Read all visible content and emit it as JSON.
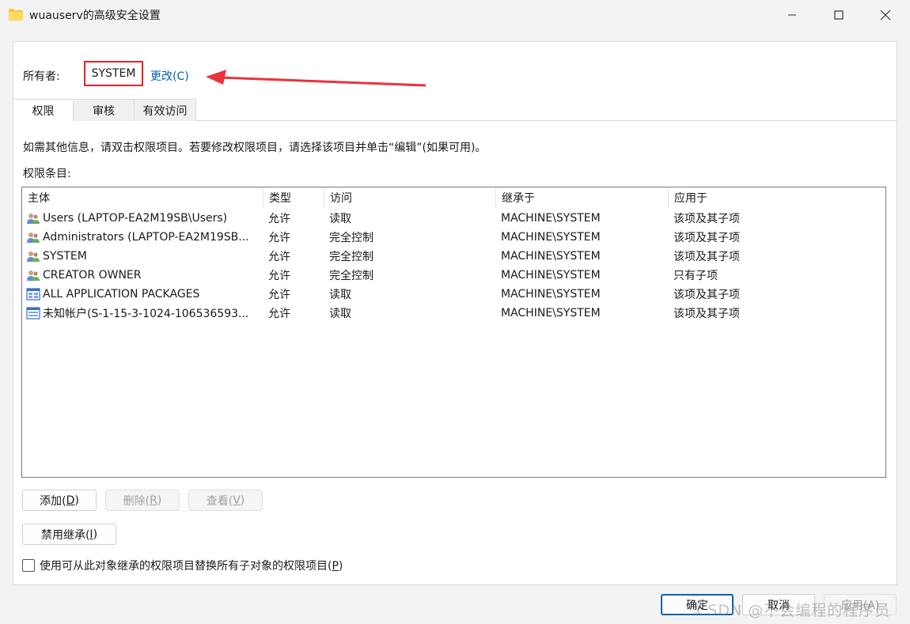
{
  "window": {
    "title": "wuauserv的高级安全设置",
    "icon": "folder-icon"
  },
  "owner": {
    "label": "所有者:",
    "value": "SYSTEM",
    "change_link": "更改(C)"
  },
  "tabs": [
    {
      "label": "权限",
      "active": true
    },
    {
      "label": "审核",
      "active": false
    },
    {
      "label": "有效访问",
      "active": false
    }
  ],
  "info_text": "如需其他信息，请双击权限项目。若要修改权限项目，请选择该项目并单击“编辑”(如果可用)。",
  "entries_label": "权限条目:",
  "table": {
    "columns": [
      "主体",
      "类型",
      "访问",
      "继承于",
      "应用于"
    ],
    "rows": [
      {
        "icon": "users-icon",
        "principal": "Users (LAPTOP-EA2M19SB\\Users)",
        "type": "允许",
        "access": "读取",
        "inherited_from": "MACHINE\\SYSTEM",
        "applies_to": "该项及其子项"
      },
      {
        "icon": "users-icon",
        "principal": "Administrators (LAPTOP-EA2M19SB...",
        "type": "允许",
        "access": "完全控制",
        "inherited_from": "MACHINE\\SYSTEM",
        "applies_to": "该项及其子项"
      },
      {
        "icon": "users-icon",
        "principal": "SYSTEM",
        "type": "允许",
        "access": "完全控制",
        "inherited_from": "MACHINE\\SYSTEM",
        "applies_to": "该项及其子项"
      },
      {
        "icon": "users-icon",
        "principal": "CREATOR OWNER",
        "type": "允许",
        "access": "完全控制",
        "inherited_from": "MACHINE\\SYSTEM",
        "applies_to": "只有子项"
      },
      {
        "icon": "app-packages-icon",
        "principal": "ALL APPLICATION PACKAGES",
        "type": "允许",
        "access": "读取",
        "inherited_from": "MACHINE\\SYSTEM",
        "applies_to": "该项及其子项"
      },
      {
        "icon": "unknown-account-icon",
        "principal": "未知帐户(S-1-15-3-1024-106536593...",
        "type": "允许",
        "access": "读取",
        "inherited_from": "MACHINE\\SYSTEM",
        "applies_to": "该项及其子项"
      }
    ]
  },
  "buttons": {
    "add": {
      "text": "添加(",
      "key": "D",
      "end": ")"
    },
    "remove": {
      "text": "删除(",
      "key": "R",
      "end": ")"
    },
    "view": {
      "text": "查看(",
      "key": "V",
      "end": ")"
    },
    "disable_inheritance": {
      "text": "禁用继承(",
      "key": "I",
      "end": ")"
    },
    "ok": "确定",
    "cancel": "取消",
    "apply": "应用(A)"
  },
  "checkbox": {
    "text": "使用可从此对象继承的权限项目替换所有子对象的权限项目(",
    "key": "P",
    "end": ")",
    "checked": false
  },
  "watermark": "CSDN @不会编程的程序员",
  "colors": {
    "accent": "#0063b1",
    "highlight_box": "#e0232b",
    "arrow": "#e8343a"
  }
}
